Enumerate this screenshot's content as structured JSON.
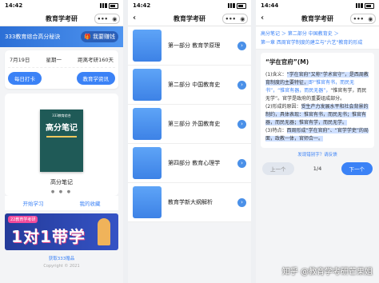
{
  "app_title": "教育学考研",
  "phone1": {
    "time": "14:42",
    "banner": {
      "title": "333教育综合高分秘诀",
      "share_label": "我要赚钱"
    },
    "info": {
      "date": "7月19日",
      "weekday": "星期一",
      "countdown": "距离考研160天"
    },
    "buttons": {
      "checkin": "每日打卡",
      "news": "教育学资讯"
    },
    "book": {
      "cover_small": "333教育综合",
      "cover_big": "高分笔记",
      "title": "高分笔记"
    },
    "links": {
      "start": "开始学习",
      "favorites": "我的收藏"
    },
    "promo": {
      "tag": "22教育学考研",
      "big": "1对1带学"
    },
    "footer": {
      "link": "获取333赠品",
      "copyright": "Copyright © 2021"
    }
  },
  "phone2": {
    "time": "14:42",
    "items": [
      {
        "label": "第一部分 教育学原理"
      },
      {
        "label": "第二部分 中国教育史"
      },
      {
        "label": "第三部分 外国教育史"
      },
      {
        "label": "第四部分 教育心理学"
      },
      {
        "label": "教育学新大纲解析"
      }
    ]
  },
  "phone3": {
    "time": "14:44",
    "breadcrumb1": "高分笔记 ＞ 第二部分 中国教育史 ＞",
    "breadcrumb2": "第一章 西周官学制度的建立与\"六艺\"教育的形成",
    "heading": "“学在官府”(M)",
    "para1a": "(1)含义：",
    "para1b": "“学在官府”又称“学术官守”，是西周教育制度的主要特征，",
    "para1c": "即“惟官有书，而民无书”，“惟官有器，而民无器”，",
    "para1d": "“惟官有学，而民无学”。官学是政府的重要组成部分。",
    "para2a": "(2)形成的原因：",
    "para2b": "受生产力发展水平和社会背景的制约，具体表现：惟官有书，而民无书；惟官有器，而民无器；惟官有学，而民无学。",
    "para3a": "(3)特点：",
    "para3b": "西周形成“学在官府”、“官学学吏”的局面，政教一体，官师合一。",
    "feedback": "发现错别字？请反馈",
    "prev": "上一个",
    "page": "1/4",
    "next": "下一个",
    "watermark": "知乎 @教育学考研芒果姐"
  }
}
